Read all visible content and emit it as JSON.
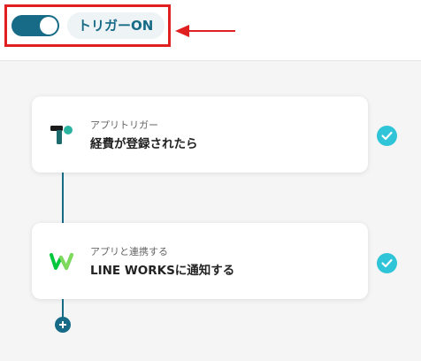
{
  "header": {
    "trigger_toggle_label": "トリガーON",
    "trigger_enabled": true
  },
  "flow": {
    "steps": [
      {
        "subtitle": "アプリトリガー",
        "title": "経費が登録されたら",
        "icon": "expense-app-icon",
        "status": "completed"
      },
      {
        "subtitle": "アプリと連携する",
        "title": "LINE WORKSに通知する",
        "icon": "line-works-icon",
        "status": "completed"
      }
    ],
    "add_step_icon": "plus-icon"
  },
  "colors": {
    "accent": "#176b87",
    "check": "#2fc4d8",
    "highlight": "#e02020"
  }
}
